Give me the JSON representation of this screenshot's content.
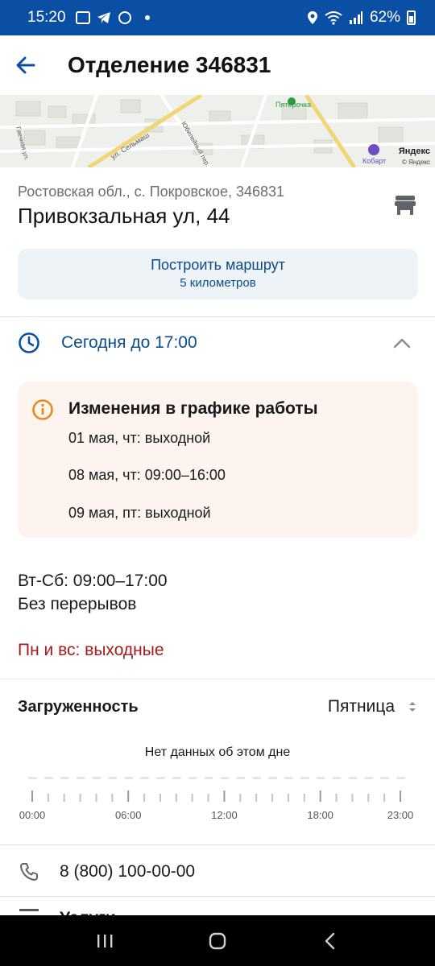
{
  "status_bar": {
    "time": "15:20",
    "battery": "62%"
  },
  "header": {
    "title": "Отделение 346831"
  },
  "map": {
    "labels": [
      "Пятёрочка",
      "Кобарт",
      "ул. Сельмаш",
      "Юбилейный пер.",
      "Гаечная ул."
    ],
    "logo": "Яндекс",
    "copyright": "© Яндекс"
  },
  "address": {
    "region": "Ростовская обл., с. Покровское, 346831",
    "street": "Привокзальная ул, 44"
  },
  "route": {
    "label": "Построить маршрут",
    "distance": "5 километров"
  },
  "hours": {
    "today": "Сегодня до 17:00"
  },
  "changes": {
    "title": "Изменения в графике работы",
    "items": [
      "01 мая, чт: выходной",
      "08 мая, чт: 09:00–16:00",
      "09 мая, пт: выходной"
    ]
  },
  "schedule": {
    "days": "Вт-Сб: 09:00–17:00",
    "break": "Без перерывов",
    "weekend": "Пн и вс: выходные"
  },
  "load": {
    "title": "Загруженность",
    "day": "Пятница",
    "no_data": "Нет данных об этом дне"
  },
  "chart_data": {
    "type": "bar",
    "title": "Загруженность",
    "tick_labels": [
      "00:00",
      "06:00",
      "12:00",
      "18:00",
      "23:00"
    ],
    "hours": [
      0,
      1,
      2,
      3,
      4,
      5,
      6,
      7,
      8,
      9,
      10,
      11,
      12,
      13,
      14,
      15,
      16,
      17,
      18,
      19,
      20,
      21,
      22,
      23
    ],
    "values": [],
    "note": "Нет данных об этом дне"
  },
  "contacts": {
    "phone": "8 (800) 100-00-00",
    "services": "Услуги"
  },
  "colors": {
    "brand": "#0a4fa3",
    "link": "#0c4b8a",
    "warning": "#e8891c",
    "danger": "#a61b1b"
  }
}
